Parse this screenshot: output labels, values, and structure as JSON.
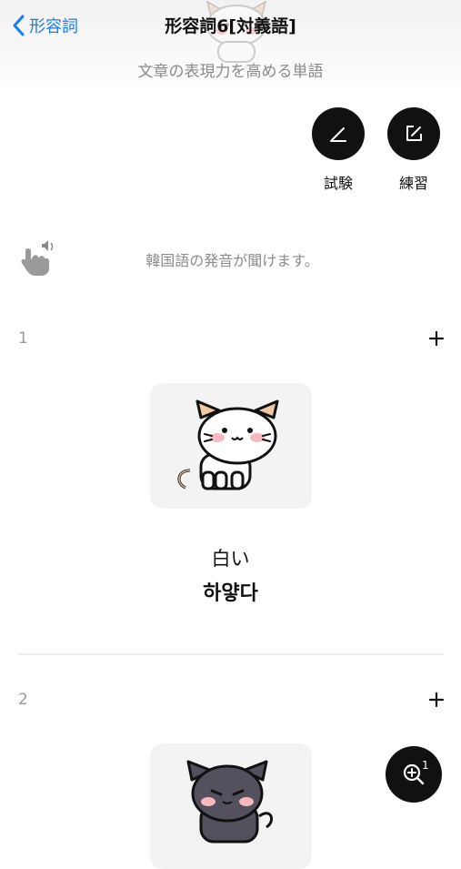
{
  "header": {
    "back_label": "形容詞",
    "title": "形容詞6[対義語]",
    "subtitle": "文章の表現力を高める単語"
  },
  "actions": {
    "test_label": "試験",
    "practice_label": "練習"
  },
  "hint": {
    "text": "韓国語の発音が聞けます。"
  },
  "items": [
    {
      "number": "1",
      "japanese": "白い",
      "korean": "하얗다",
      "image": "white-cat-illustration"
    },
    {
      "number": "2",
      "japanese": "",
      "korean": "",
      "image": "dark-cat-illustration"
    }
  ],
  "zoom": {
    "count": "1"
  },
  "colors": {
    "accent": "#1a7cf5",
    "button_dark": "#111111",
    "muted_text": "#8c8c8c",
    "card_bg": "#f3f3f3"
  }
}
